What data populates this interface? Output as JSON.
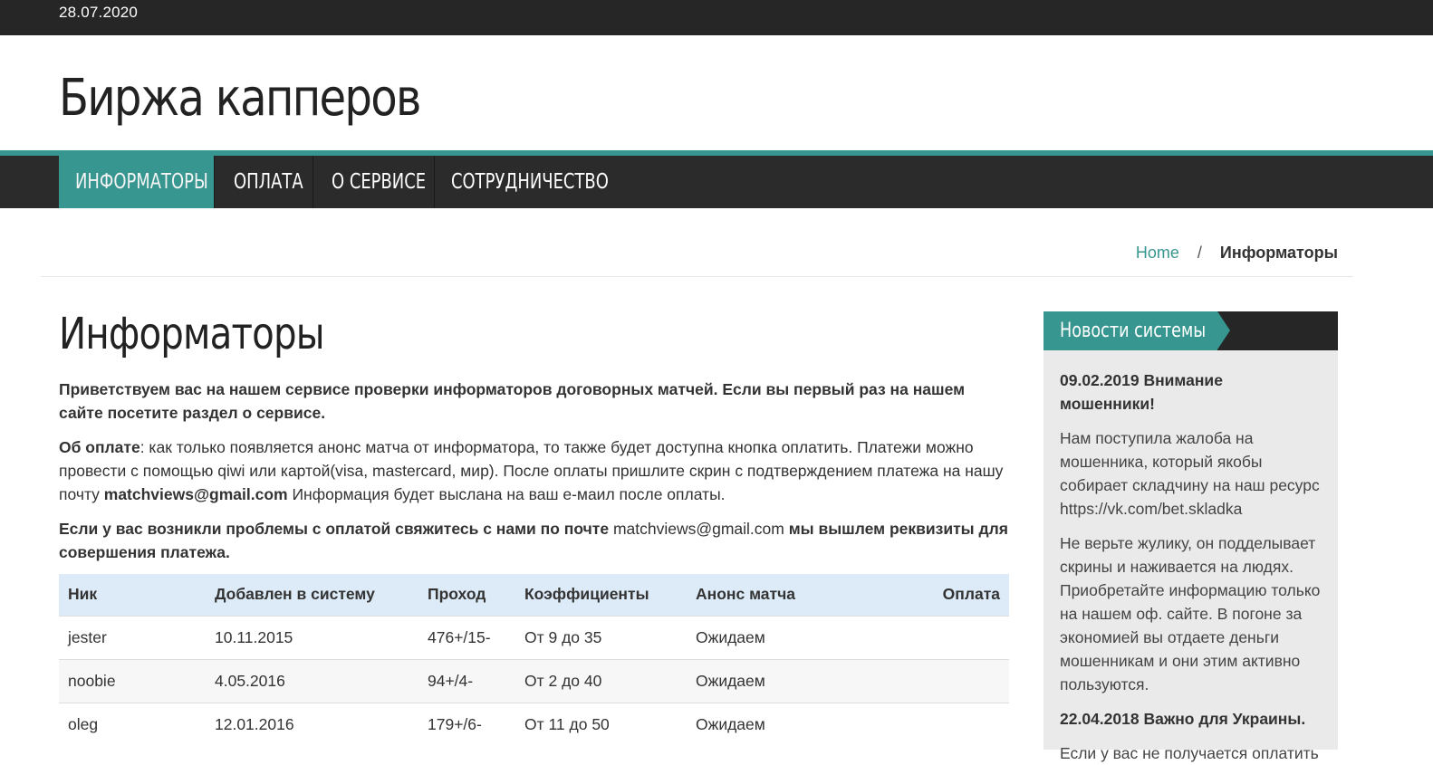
{
  "topbar": {
    "date": "28.07.2020"
  },
  "header": {
    "site_title": "Биржа капперов"
  },
  "nav": {
    "items": [
      {
        "label": "Информаторы"
      },
      {
        "label": "Оплата"
      },
      {
        "label": "О сервисе"
      },
      {
        "label": "Сотрудничество"
      }
    ]
  },
  "breadcrumb": {
    "home": "Home",
    "separator": "/",
    "current": "Информаторы"
  },
  "main": {
    "title": "Информаторы",
    "intro": "Приветствуем вас на нашем сервисе проверки информаторов договорных матчей. Если вы первый раз на нашем сайте посетите раздел о сервисе.",
    "payment_label": "Об оплате",
    "payment_text_1": ": как только появляется анонс матча от информатора, то также будет доступна кнопка оплатить. Платежи можно провести с помощью qiwi или картой(visa, mastercard, мир). После оплаты пришлите скрин с подтверждением платежа на нашу почту ",
    "payment_email": "matchviews@gmail.com",
    "payment_text_2": " Информация будет выслана на ваш е-маил после оплаты.",
    "problems_text_1": "Если у вас возникли проблемы с оплатой свяжитесь с нами по почте ",
    "problems_email": "matchviews@gmail.com",
    "problems_text_2": " мы вышлем реквизиты для совершения платежа."
  },
  "table": {
    "headers": [
      "Ник",
      "Добавлен в систему",
      "Проход",
      "Коэффициенты",
      "Анонс матча",
      "Оплата"
    ],
    "rows": [
      [
        "jester",
        "10.11.2015",
        "476+/15-",
        "От 9 до 35",
        "Ожидаем",
        ""
      ],
      [
        "noobie",
        "4.05.2016",
        "94+/4-",
        "От 2 до 40",
        "Ожидаем",
        ""
      ],
      [
        "oleg",
        "12.01.2016",
        "179+/6-",
        "От 11 до 50",
        "Ожидаем",
        ""
      ]
    ]
  },
  "sidebar": {
    "title": "Новости системы",
    "news": [
      {
        "heading": "09.02.2019 Внимание мошенники!",
        "paragraphs": [
          "Нам поступила жалоба на мошенника, который якобы собирает складчину на наш ресурс https://vk.com/bet.skladka",
          "Не верьте жулику, он подделывает скрины и наживается на людях. Приобретайте информацию только на нашем оф. сайте. В погоне за экономией вы отдаете деньги мошенникам и они этим активно пользуются."
        ]
      },
      {
        "heading": "22.04.2018 Важно для Украины.",
        "paragraphs": [
          "Если у вас не получается оплатить"
        ]
      }
    ]
  },
  "colors": {
    "accent": "#37968f",
    "dark_bar": "#262626",
    "table_header": "#dcebf7"
  }
}
